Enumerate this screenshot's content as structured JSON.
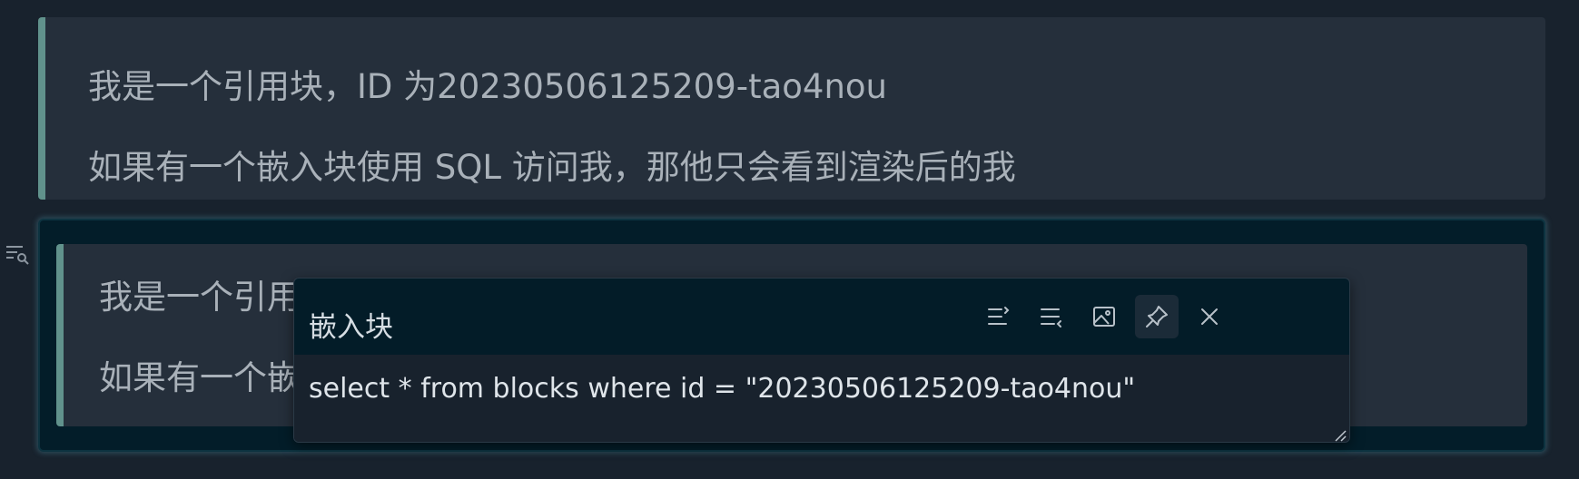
{
  "quote_block": {
    "line1": "我是一个引用块，ID 为20230506125209-tao4nou",
    "line2": "如果有一个嵌入块使用 SQL 访问我，那他只会看到渲染后的我"
  },
  "embed_block": {
    "line1": "我是一个引用",
    "line2": "如果有一个嵌入"
  },
  "embed_popup": {
    "title": "嵌入块",
    "query": "select * from blocks where id = \"20230506125209-tao4nou\"",
    "toolbar": [
      "headings-expand-icon",
      "headings-collapse-icon",
      "image-icon",
      "pin-icon",
      "close-icon"
    ]
  },
  "side_icon": "embed-query-icon",
  "colors": {
    "background": "#18222d",
    "quote_bg": "#252f3b",
    "quote_border": "#61928c",
    "embed_bg": "#031d29"
  }
}
